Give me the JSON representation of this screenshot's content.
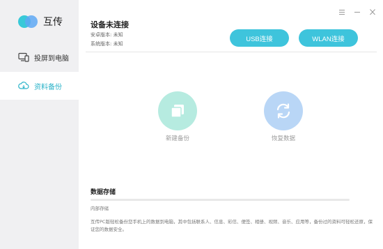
{
  "app": {
    "name": "互传"
  },
  "sidebar": {
    "items": [
      {
        "label": "投屏到电脑",
        "icon": "monitor-phone-icon"
      },
      {
        "label": "资料备份",
        "icon": "cloud-icon"
      }
    ]
  },
  "window_controls": [
    "menu-icon",
    "minimize-icon",
    "close-icon"
  ],
  "device": {
    "status": "设备未连接",
    "android_version": "安卓版本: 未知",
    "system_version": "系统版本: 未知"
  },
  "buttons": {
    "usb": "USB连接",
    "wlan": "WLAN连接"
  },
  "actions": {
    "new_backup": "新建备份",
    "restore": "恢复数据"
  },
  "storage": {
    "title": "数据存储",
    "subtitle": "内部存储",
    "description": "互传PC版轻松备份您手机上的数据到电脑，其中包括联系人、信息、彩信、便签、相册、视频、音乐、应用等，备份过的资料可轻松还原，保证您的数据安全。"
  },
  "colors": {
    "accent": "#3ec4dc",
    "sidebar_bg": "#f0f0f2",
    "new_backup": "#b6ebe0",
    "restore": "#b9d6f6"
  }
}
